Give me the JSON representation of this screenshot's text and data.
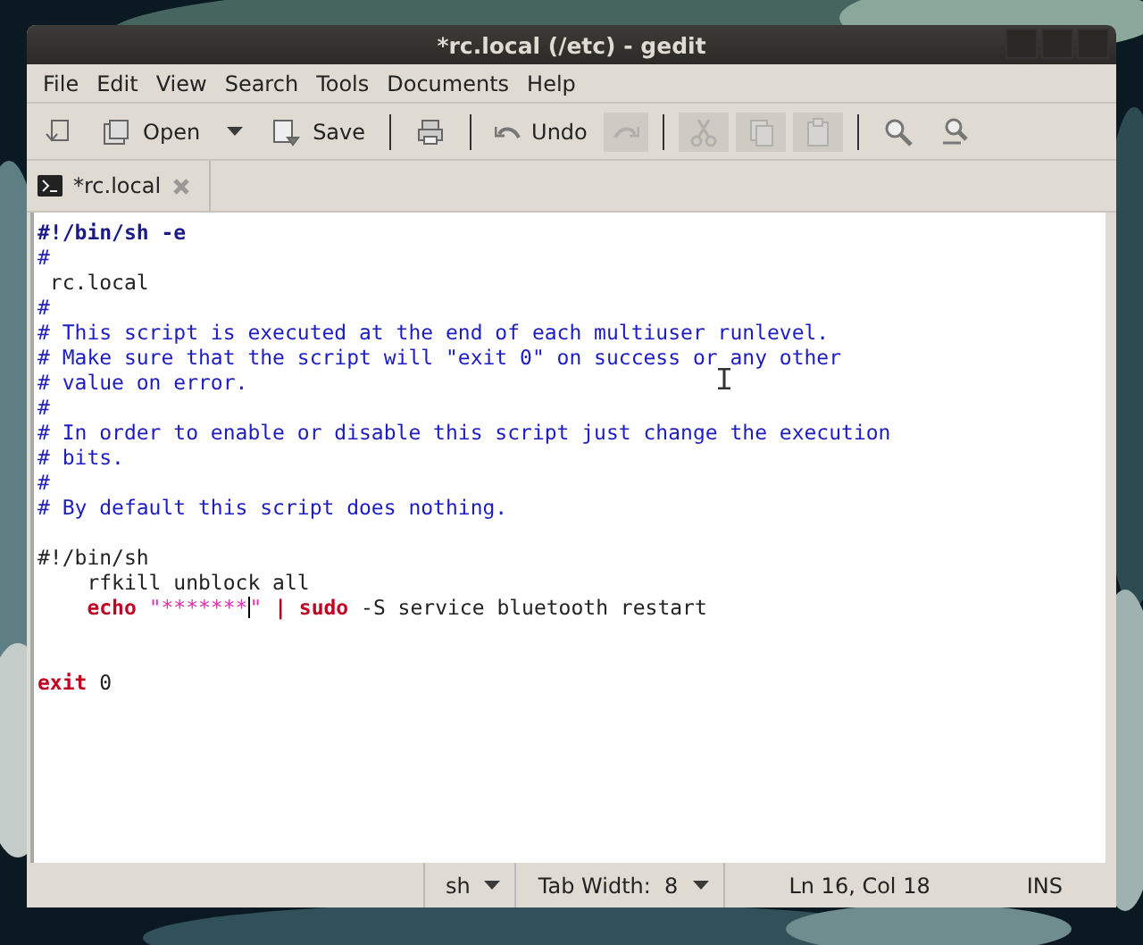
{
  "window": {
    "title": "*rc.local (/etc) - gedit"
  },
  "menu": [
    "File",
    "Edit",
    "View",
    "Search",
    "Tools",
    "Documents",
    "Help"
  ],
  "toolbar": [
    {
      "kind": "button",
      "disabled": false
    },
    {
      "kind": "button",
      "label": "Open",
      "disabled": false
    },
    {
      "kind": "dropdown"
    },
    {
      "kind": "button",
      "label": "Save",
      "disabled": false
    },
    {
      "kind": "separator"
    },
    {
      "kind": "button",
      "disabled": false
    },
    {
      "kind": "separator"
    },
    {
      "kind": "button",
      "label": "Undo",
      "disabled": false
    },
    {
      "kind": "button",
      "disabled": true
    },
    {
      "kind": "separator"
    },
    {
      "kind": "button",
      "disabled": true
    },
    {
      "kind": "button",
      "disabled": true
    },
    {
      "kind": "button",
      "disabled": true
    },
    {
      "kind": "separator"
    },
    {
      "kind": "button",
      "disabled": false
    },
    {
      "kind": "button",
      "disabled": false
    }
  ],
  "tabs": [
    {
      "label": "*rc.local",
      "selected": true
    }
  ],
  "editor": {
    "lines": [
      {
        "kind": "code",
        "tokens": [
          {
            "kind": "shebang",
            "text": "#!/bin/sh -e"
          }
        ]
      },
      {
        "kind": "code",
        "tokens": [
          {
            "kind": "comment",
            "text": "#"
          }
        ]
      },
      {
        "kind": "code",
        "tokens": [
          {
            "kind": "plain",
            "text": " rc.local"
          }
        ]
      },
      {
        "kind": "code",
        "tokens": [
          {
            "kind": "comment",
            "text": "#"
          }
        ]
      },
      {
        "kind": "code",
        "tokens": [
          {
            "kind": "comment",
            "text": "# This script is executed at the end of each multiuser runlevel."
          }
        ]
      },
      {
        "kind": "code",
        "tokens": [
          {
            "kind": "comment",
            "text": "# Make sure that the script will \"exit 0\" on success or any other"
          }
        ]
      },
      {
        "kind": "code",
        "tokens": [
          {
            "kind": "comment",
            "text": "# value on error."
          }
        ]
      },
      {
        "kind": "code",
        "tokens": [
          {
            "kind": "comment",
            "text": "#"
          }
        ]
      },
      {
        "kind": "code",
        "tokens": [
          {
            "kind": "comment",
            "text": "# In order to enable or disable this script just change the execution"
          }
        ]
      },
      {
        "kind": "code",
        "tokens": [
          {
            "kind": "comment",
            "text": "# bits."
          }
        ]
      },
      {
        "kind": "code",
        "tokens": [
          {
            "kind": "comment",
            "text": "#"
          }
        ]
      },
      {
        "kind": "code",
        "tokens": [
          {
            "kind": "comment",
            "text": "# By default this script does nothing."
          }
        ]
      },
      {
        "kind": "blank"
      },
      {
        "kind": "code",
        "tokens": [
          {
            "kind": "plain",
            "text": "#!/bin/sh"
          }
        ]
      },
      {
        "kind": "code",
        "tokens": [
          {
            "kind": "plain",
            "text": "    rfkill unblock all"
          }
        ]
      },
      {
        "kind": "code",
        "tokens": [
          {
            "kind": "keyword",
            "text": "    echo"
          },
          {
            "kind": "string",
            "text": " \"*******"
          },
          {
            "kind": "cursor"
          },
          {
            "kind": "string",
            "text": "\" "
          },
          {
            "kind": "keyword",
            "text": "| sudo"
          },
          {
            "kind": "plain",
            "text": " -S service bluetooth restart"
          }
        ]
      },
      {
        "kind": "blank"
      },
      {
        "kind": "blank"
      },
      {
        "kind": "code",
        "tokens": [
          {
            "kind": "keyword",
            "text": "exit"
          },
          {
            "kind": "plain",
            "text": " 0"
          }
        ]
      }
    ]
  },
  "status_bar": [
    {
      "kind": "dropdown",
      "text": "sh"
    },
    {
      "kind": "dropdown",
      "text": "Tab Width:  8"
    },
    {
      "kind": "text",
      "text": "Ln 16, Col 18"
    },
    {
      "kind": "text",
      "text": "INS"
    }
  ]
}
